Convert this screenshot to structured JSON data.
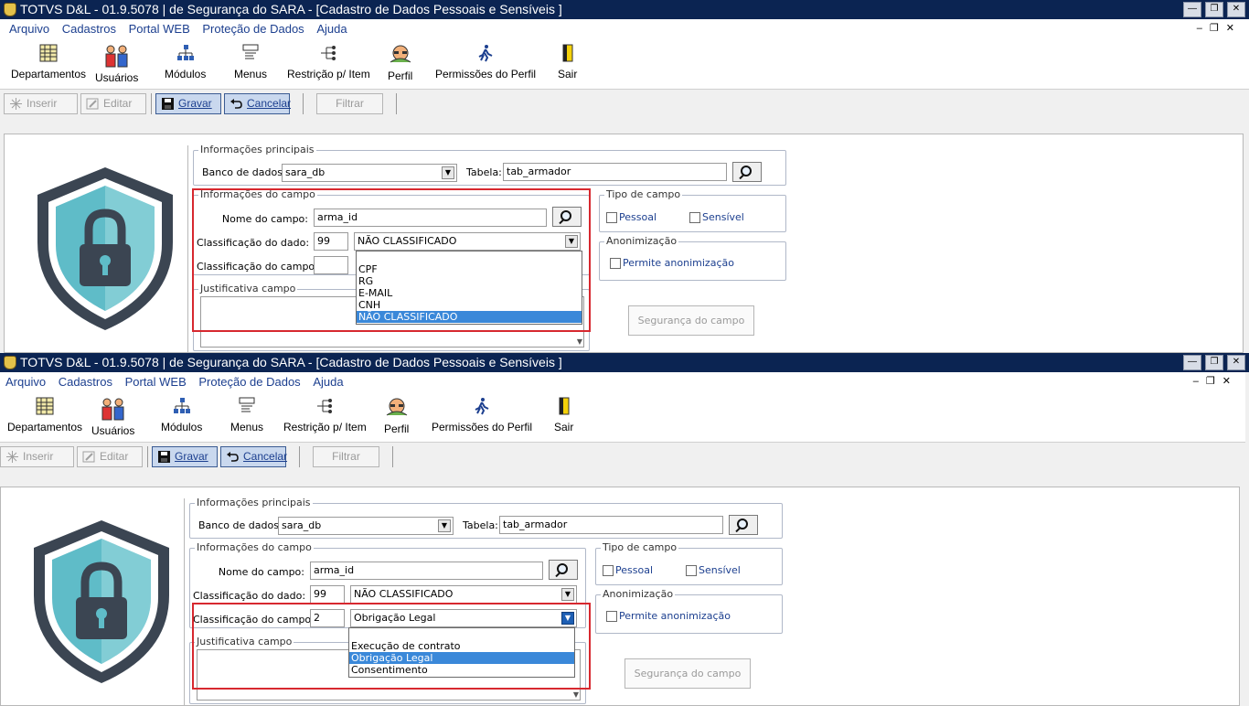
{
  "panes": [
    {
      "window_title": "TOTVS D&L - 01.9.5078 | de Segurança do SARA - [Cadastro de Dados Pessoais e Sensíveis ]",
      "menu": [
        "Arquivo",
        "Cadastros",
        "Portal WEB",
        "Proteção de Dados",
        "Ajuda"
      ],
      "iconbar": [
        "Departamentos",
        "Usuários",
        "Módulos",
        "Menus",
        "Restrição p/ Item",
        "Perfil",
        "Permissões do Perfil",
        "Sair"
      ],
      "toolbar": {
        "inserir": "Inserir",
        "editar": "Editar",
        "gravar": "Gravar",
        "cancelar": "Cancelar",
        "filtrar": "Filtrar"
      },
      "info_principais": {
        "title": "Informações principais",
        "db_label": "Banco de dados:",
        "db_value": "sara_db",
        "table_label": "Tabela:",
        "table_value": "tab_armador"
      },
      "info_campo": {
        "title": "Informações do campo",
        "nome_label": "Nome do campo:",
        "nome_value": "arma_id",
        "class_dado_label": "Classificação do dado:",
        "class_dado_code": "99",
        "class_dado_value": "NÃO CLASSIFICADO",
        "class_campo_label": "Classificação do campo:",
        "class_campo_code": "",
        "class_campo_value": ""
      },
      "tipo_campo": {
        "title": "Tipo de campo",
        "pessoal": "Pessoal",
        "sensivel": "Sensível"
      },
      "anonimizacao": {
        "title": "Anonimização",
        "permite": "Permite anonimização"
      },
      "justificativa": {
        "title": "Justificativa campo"
      },
      "seguranca_button": "Segurança do campo",
      "popup_options": [
        "",
        "CPF",
        "RG",
        "E-MAIL",
        "CNH",
        "NÃO CLASSIFICADO"
      ],
      "popup_selected": "NÃO CLASSIFICADO"
    },
    {
      "window_title": "TOTVS D&L - 01.9.5078 | de Segurança do SARA - [Cadastro de Dados Pessoais e Sensíveis ]",
      "menu": [
        "Arquivo",
        "Cadastros",
        "Portal WEB",
        "Proteção de Dados",
        "Ajuda"
      ],
      "iconbar": [
        "Departamentos",
        "Usuários",
        "Módulos",
        "Menus",
        "Restrição p/ Item",
        "Perfil",
        "Permissões do Perfil",
        "Sair"
      ],
      "toolbar": {
        "inserir": "Inserir",
        "editar": "Editar",
        "gravar": "Gravar",
        "cancelar": "Cancelar",
        "filtrar": "Filtrar"
      },
      "info_principais": {
        "title": "Informações principais",
        "db_label": "Banco de dados:",
        "db_value": "sara_db",
        "table_label": "Tabela:",
        "table_value": "tab_armador"
      },
      "info_campo": {
        "title": "Informações do campo",
        "nome_label": "Nome do campo:",
        "nome_value": "arma_id",
        "class_dado_label": "Classificação do dado:",
        "class_dado_code": "99",
        "class_dado_value": "NÃO CLASSIFICADO",
        "class_campo_label": "Classificação do campo:",
        "class_campo_code": "2",
        "class_campo_value": "Obrigação Legal"
      },
      "tipo_campo": {
        "title": "Tipo de campo",
        "pessoal": "Pessoal",
        "sensivel": "Sensível"
      },
      "anonimizacao": {
        "title": "Anonimização",
        "permite": "Permite anonimização"
      },
      "justificativa": {
        "title": "Justificativa campo"
      },
      "seguranca_button": "Segurança do campo",
      "popup_options": [
        "",
        "Execução de contrato",
        "Obrigação Legal",
        "Consentimento"
      ],
      "popup_selected": "Obrigação Legal"
    }
  ],
  "colors": {
    "titlebar": "#0b2452",
    "link": "#1c3f8f",
    "highlight_box": "#d7282f",
    "selection": "#3a88d9",
    "shield_teal": "#5fbcc8",
    "shield_dark": "#3b4552"
  }
}
